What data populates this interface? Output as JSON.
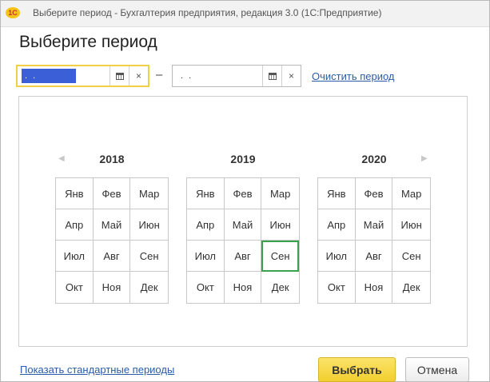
{
  "window": {
    "title": "Выберите период - Бухгалтерия предприятия, редакция 3.0  (1С:Предприятие)",
    "logo_text": "1С"
  },
  "heading": "Выберите период",
  "period": {
    "start_value": ". .",
    "separator": "–",
    "end_value": ". .",
    "clear_icon": "×",
    "calendar_icon": "calendar-icon",
    "clear_link": "Очистить период"
  },
  "calendar": {
    "nav_prev": "◀",
    "nav_next": "▶",
    "years": [
      {
        "year": "2018",
        "months": [
          "Янв",
          "Фев",
          "Мар",
          "Апр",
          "Май",
          "Июн",
          "Июл",
          "Авг",
          "Сен",
          "Окт",
          "Ноя",
          "Дек"
        ]
      },
      {
        "year": "2019",
        "months": [
          "Янв",
          "Фев",
          "Мар",
          "Апр",
          "Май",
          "Июн",
          "Июл",
          "Авг",
          "Сен",
          "Окт",
          "Ноя",
          "Дек"
        ]
      },
      {
        "year": "2020",
        "months": [
          "Янв",
          "Фев",
          "Мар",
          "Апр",
          "Май",
          "Июн",
          "Июл",
          "Авг",
          "Сен",
          "Окт",
          "Ноя",
          "Дек"
        ]
      }
    ],
    "selected": {
      "year": "2019",
      "month": "Сен"
    }
  },
  "footer": {
    "standard_periods_link": "Показать стандартные периоды",
    "select_button": "Выбрать",
    "cancel_button": "Отмена"
  },
  "colors": {
    "accent_yellow": "#f2cf2f",
    "link_blue": "#2a5ca8",
    "selected_green": "#3aa14c",
    "selection_blue": "#3b5fd6"
  }
}
